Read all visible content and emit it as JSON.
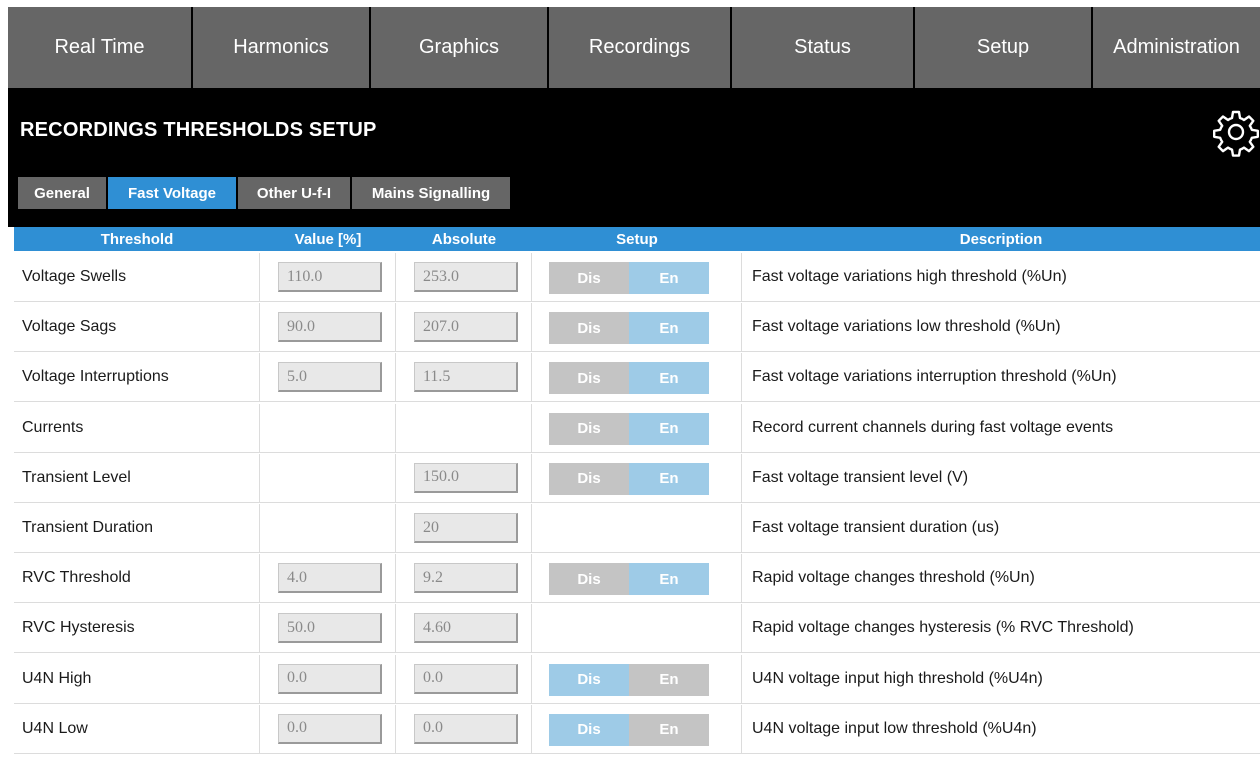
{
  "nav": {
    "items": [
      "Real Time",
      "Harmonics",
      "Graphics",
      "Recordings",
      "Status",
      "Setup",
      "Administration"
    ]
  },
  "page": {
    "title": "RECORDINGS THRESHOLDS SETUP"
  },
  "subtabs": {
    "items": [
      "General",
      "Fast Voltage",
      "Other U-f-I",
      "Mains Signalling"
    ],
    "active": "Fast Voltage"
  },
  "table": {
    "headers": [
      "Threshold",
      "Value [%]",
      "Absolute",
      "Setup",
      "Description"
    ],
    "toggle_labels": {
      "dis": "Dis",
      "en": "En"
    },
    "rows": [
      {
        "label": "Voltage Swells",
        "value": "110.0",
        "absolute": "253.0",
        "setup": "En",
        "description": "Fast voltage variations high threshold (%Un)"
      },
      {
        "label": "Voltage Sags",
        "value": "90.0",
        "absolute": "207.0",
        "setup": "En",
        "description": "Fast voltage variations low threshold (%Un)"
      },
      {
        "label": "Voltage Interruptions",
        "value": "5.0",
        "absolute": "11.5",
        "setup": "En",
        "description": "Fast voltage variations interruption threshold (%Un)"
      },
      {
        "label": "Currents",
        "value": null,
        "absolute": null,
        "setup": "En",
        "description": "Record current channels during fast voltage events"
      },
      {
        "label": "Transient Level",
        "value": null,
        "absolute": "150.0",
        "setup": "En",
        "description": "Fast voltage transient level (V)"
      },
      {
        "label": "Transient Duration",
        "value": null,
        "absolute": "20",
        "setup": null,
        "description": "Fast voltage transient duration (us)"
      },
      {
        "label": "RVC Threshold",
        "value": "4.0",
        "absolute": "9.2",
        "setup": "En",
        "description": "Rapid voltage changes threshold (%Un)"
      },
      {
        "label": "RVC Hysteresis",
        "value": "50.0",
        "absolute": "4.60",
        "setup": null,
        "description": "Rapid voltage changes hysteresis (% RVC Threshold)"
      },
      {
        "label": "U4N High",
        "value": "0.0",
        "absolute": "0.0",
        "setup": "Dis",
        "description": "U4N voltage input high threshold (%U4n)"
      },
      {
        "label": "U4N Low",
        "value": "0.0",
        "absolute": "0.0",
        "setup": "Dis",
        "description": "U4N voltage input low threshold (%U4n)"
      }
    ]
  },
  "colors": {
    "nav_bg": "#666666",
    "accent_blue": "#2f8fd4",
    "toggle_selected": "#9ecbe7",
    "toggle_unselected": "#c4c4c4",
    "background": "#000000"
  },
  "icons": {
    "settings": "gear-icon"
  }
}
